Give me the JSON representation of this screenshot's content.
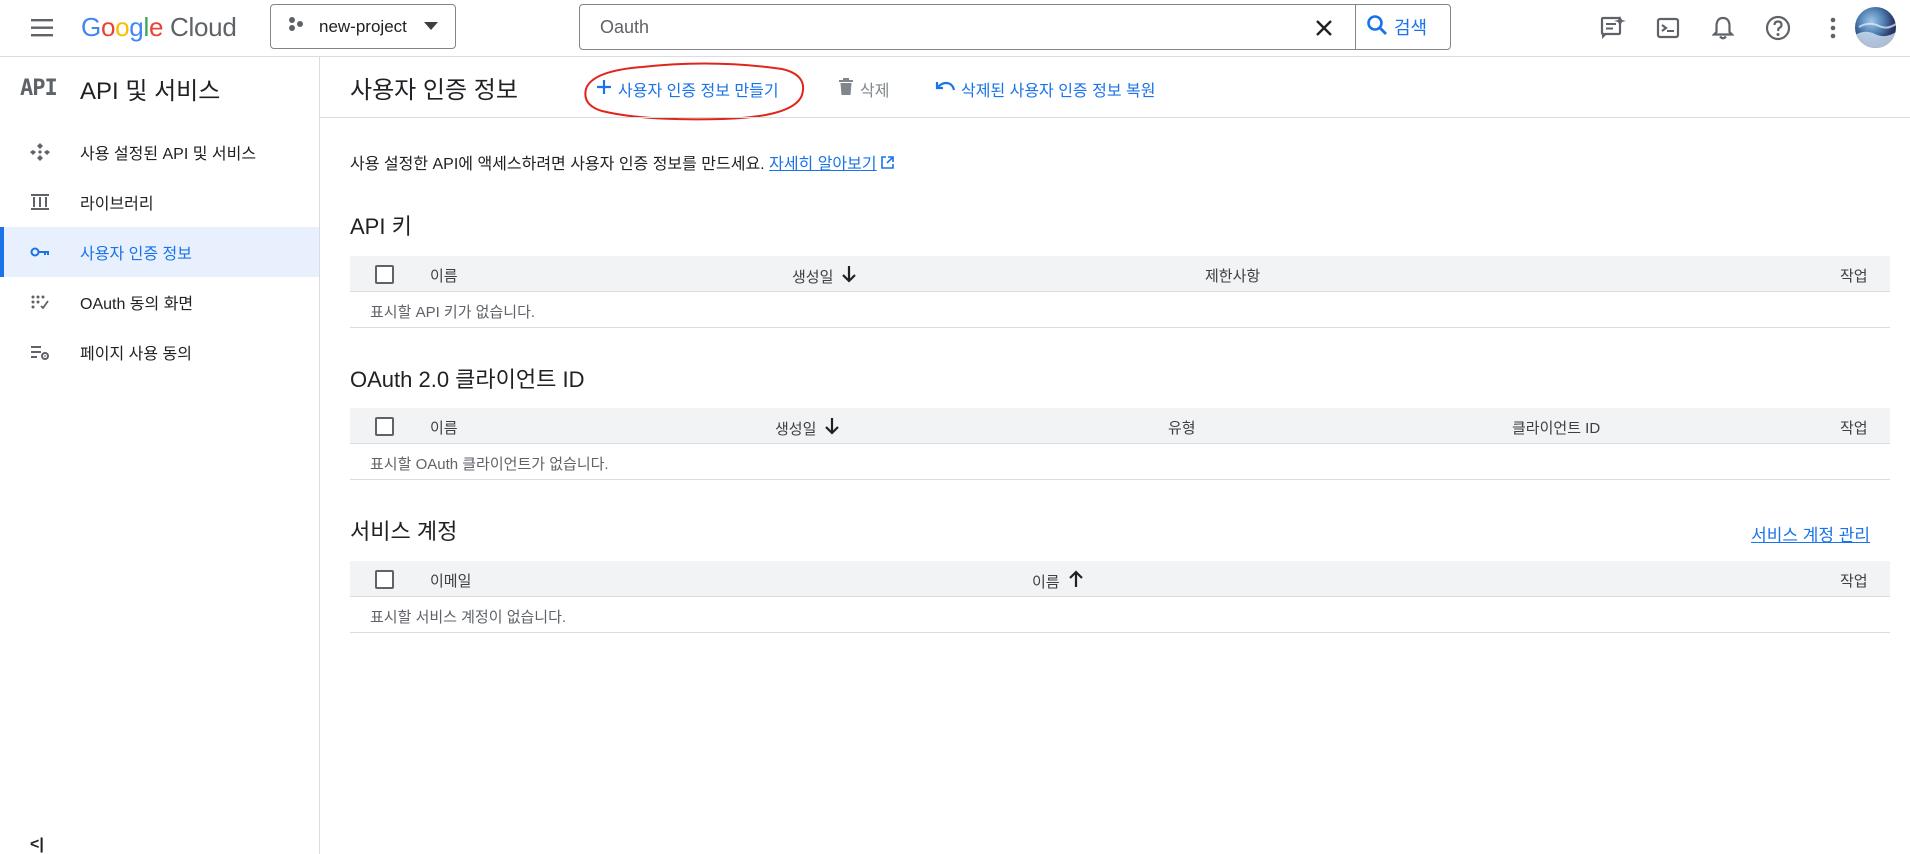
{
  "header": {
    "logo_google": "Google",
    "logo_cloud": "Cloud",
    "project_name": "new-project",
    "search_value": "Oauth",
    "search_button": "검색"
  },
  "sidebar": {
    "glyph": "API",
    "title": "API 및 서비스",
    "items": [
      {
        "label": "사용 설정된 API 및 서비스",
        "icon": "api-diamond-icon"
      },
      {
        "label": "라이브러리",
        "icon": "library-icon"
      },
      {
        "label": "사용자 인증 정보",
        "icon": "key-icon",
        "active": true
      },
      {
        "label": "OAuth 동의 화면",
        "icon": "oauth-dots-icon"
      },
      {
        "label": "페이지 사용 동의",
        "icon": "settings-list-icon"
      }
    ],
    "collapse": "<|"
  },
  "page": {
    "title": "사용자 인증 정보",
    "actions": {
      "create": "사용자 인증 정보 만들기",
      "delete": "삭제",
      "restore": "삭제된 사용자 인증 정보 복원"
    },
    "intro_text": "사용 설정한 API에 액세스하려면 사용자 인증 정보를 만드세요.",
    "intro_link": "자세히 알아보기"
  },
  "api_keys": {
    "title": "API 키",
    "columns": [
      "이름",
      "생성일",
      "제한사항",
      "작업"
    ],
    "empty": "표시할 API 키가 없습니다."
  },
  "oauth_clients": {
    "title": "OAuth 2.0 클라이언트 ID",
    "columns": [
      "이름",
      "생성일",
      "유형",
      "클라이언트 ID",
      "작업"
    ],
    "empty": "표시할 OAuth 클라이언트가 없습니다."
  },
  "service_accounts": {
    "title": "서비스 계정",
    "manage_link": "서비스 계정 관리",
    "columns": [
      "이메일",
      "이름",
      "작업"
    ],
    "empty": "표시할 서비스 계정이 없습니다."
  },
  "colors": {
    "accent": "#1a73e8",
    "active_bg": "#e8f0fe",
    "annotation": "#e0251b"
  }
}
